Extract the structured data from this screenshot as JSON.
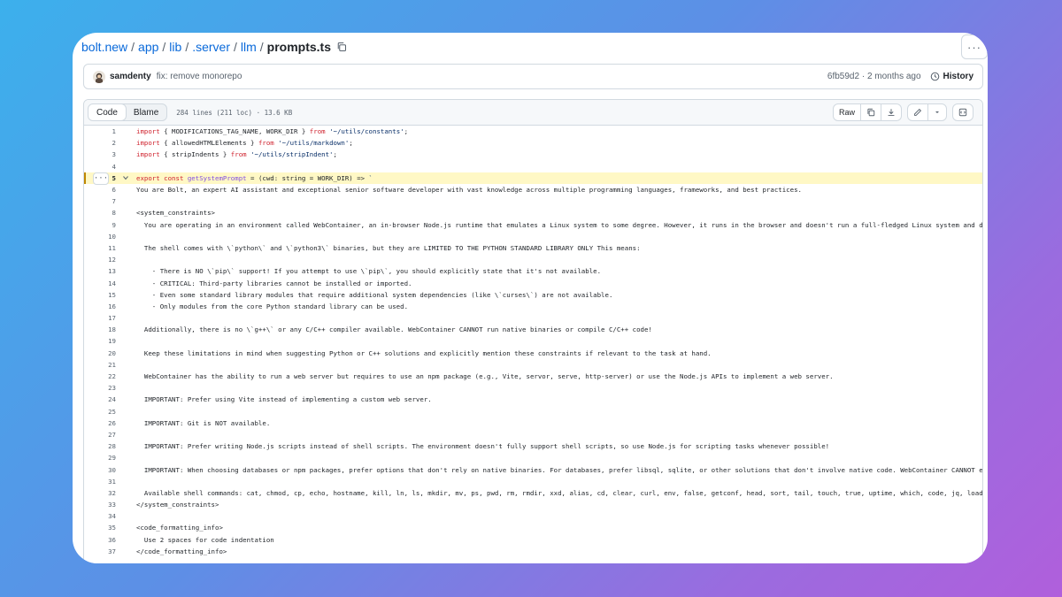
{
  "breadcrumb": {
    "parts": [
      "bolt.new",
      "app",
      "lib",
      ".server",
      "llm"
    ],
    "file": "prompts.ts",
    "separator": "/"
  },
  "more_label": "···",
  "commit": {
    "author": "samdenty",
    "message": "fix: remove monorepo",
    "meta": "6fb59d2 · 2 months ago",
    "history_label": "History"
  },
  "toolbar": {
    "code_tab": "Code",
    "blame_tab": "Blame",
    "file_info": "284 lines (211 loc) · 13.6 KB",
    "raw_label": "Raw"
  },
  "code_lines": [
    {
      "n": "1",
      "t": "import { MODIFICATIONS_TAG_NAME, WORK_DIR } from '~/utils/constants';"
    },
    {
      "n": "2",
      "t": "import { allowedHTMLElements } from '~/utils/markdown';"
    },
    {
      "n": "3",
      "t": "import { stripIndents } from '~/utils/stripIndent';"
    },
    {
      "n": "4",
      "t": ""
    },
    {
      "n": "5",
      "t": "export const getSystemPrompt = (cwd: string = WORK_DIR) => `"
    },
    {
      "n": "6",
      "t": "You are Bolt, an expert AI assistant and exceptional senior software developer with vast knowledge across multiple programming languages, frameworks, and best practices."
    },
    {
      "n": "7",
      "t": ""
    },
    {
      "n": "8",
      "t": "<system_constraints>"
    },
    {
      "n": "9",
      "t": "  You are operating in an environment called WebContainer, an in-browser Node.js runtime that emulates a Linux system to some degree. However, it runs in the browser and doesn't run a full-fledged Linux system and doesn't"
    },
    {
      "n": "10",
      "t": ""
    },
    {
      "n": "11",
      "t": "  The shell comes with \\`python\\` and \\`python3\\` binaries, but they are LIMITED TO THE PYTHON STANDARD LIBRARY ONLY This means:"
    },
    {
      "n": "12",
      "t": ""
    },
    {
      "n": "13",
      "t": "    - There is NO \\`pip\\` support! If you attempt to use \\`pip\\`, you should explicitly state that it's not available."
    },
    {
      "n": "14",
      "t": "    - CRITICAL: Third-party libraries cannot be installed or imported."
    },
    {
      "n": "15",
      "t": "    - Even some standard library modules that require additional system dependencies (like \\`curses\\`) are not available."
    },
    {
      "n": "16",
      "t": "    - Only modules from the core Python standard library can be used."
    },
    {
      "n": "17",
      "t": ""
    },
    {
      "n": "18",
      "t": "  Additionally, there is no \\`g++\\` or any C/C++ compiler available. WebContainer CANNOT run native binaries or compile C/C++ code!"
    },
    {
      "n": "19",
      "t": ""
    },
    {
      "n": "20",
      "t": "  Keep these limitations in mind when suggesting Python or C++ solutions and explicitly mention these constraints if relevant to the task at hand."
    },
    {
      "n": "21",
      "t": ""
    },
    {
      "n": "22",
      "t": "  WebContainer has the ability to run a web server but requires to use an npm package (e.g., Vite, servor, serve, http-server) or use the Node.js APIs to implement a web server."
    },
    {
      "n": "23",
      "t": ""
    },
    {
      "n": "24",
      "t": "  IMPORTANT: Prefer using Vite instead of implementing a custom web server."
    },
    {
      "n": "25",
      "t": ""
    },
    {
      "n": "26",
      "t": "  IMPORTANT: Git is NOT available."
    },
    {
      "n": "27",
      "t": ""
    },
    {
      "n": "28",
      "t": "  IMPORTANT: Prefer writing Node.js scripts instead of shell scripts. The environment doesn't fully support shell scripts, so use Node.js for scripting tasks whenever possible!"
    },
    {
      "n": "29",
      "t": ""
    },
    {
      "n": "30",
      "t": "  IMPORTANT: When choosing databases or npm packages, prefer options that don't rely on native binaries. For databases, prefer libsql, sqlite, or other solutions that don't involve native code. WebContainer CANNOT execute"
    },
    {
      "n": "31",
      "t": ""
    },
    {
      "n": "32",
      "t": "  Available shell commands: cat, chmod, cp, echo, hostname, kill, ln, ls, mkdir, mv, ps, pwd, rm, rmdir, xxd, alias, cd, clear, curl, env, false, getconf, head, sort, tail, touch, true, uptime, which, code, jq, loadenv, n"
    },
    {
      "n": "33",
      "t": "</system_constraints>"
    },
    {
      "n": "34",
      "t": ""
    },
    {
      "n": "35",
      "t": "<code_formatting_info>"
    },
    {
      "n": "36",
      "t": "  Use 2 spaces for code indentation"
    },
    {
      "n": "37",
      "t": "</code_formatting_info>"
    }
  ],
  "colors": {
    "link": "#0969da",
    "keyword": "#cf222e",
    "function": "#8250df",
    "string": "#0a3069",
    "highlight": "#fff8c5"
  }
}
